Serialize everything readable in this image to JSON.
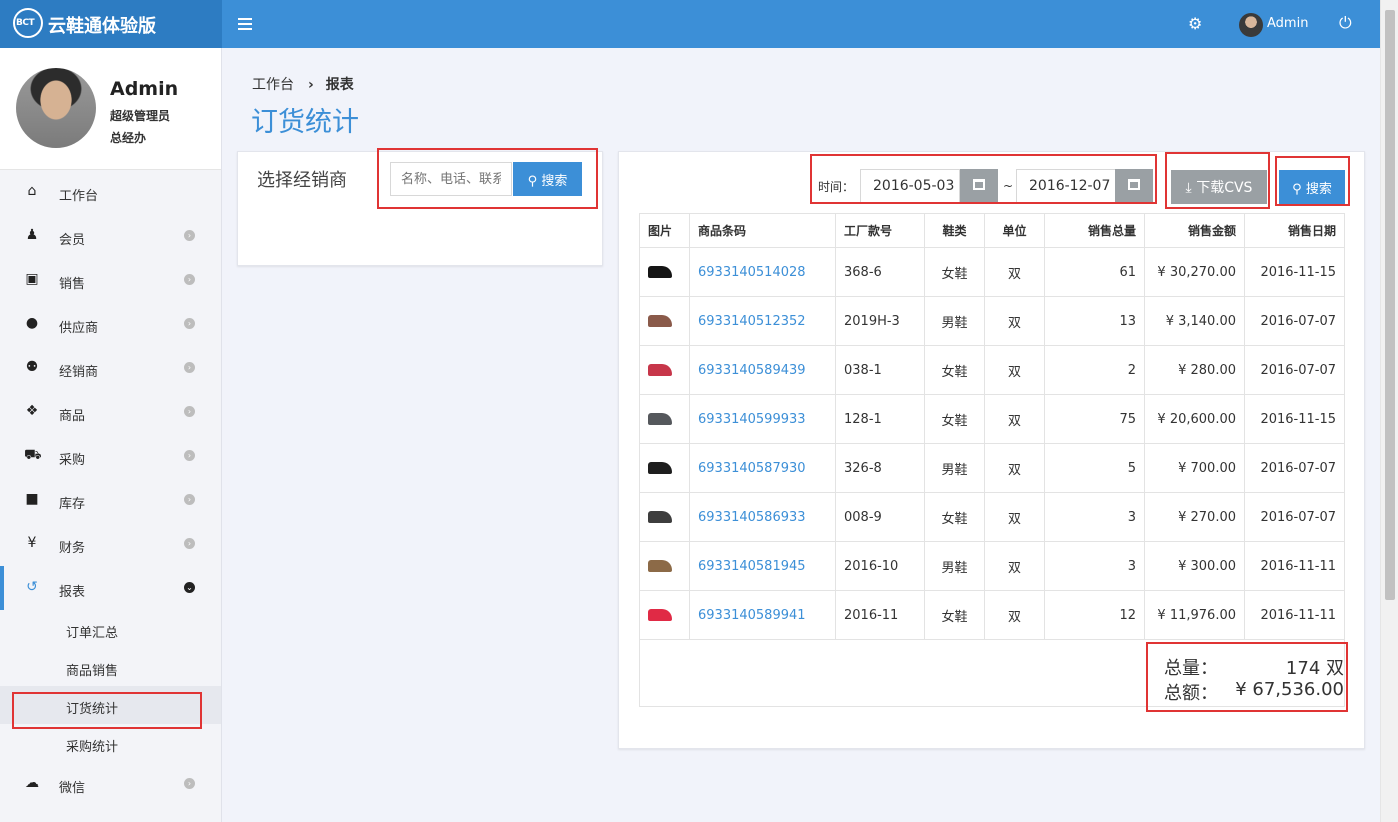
{
  "brand": {
    "logo_text": "BCT",
    "title": "云鞋通体验版"
  },
  "topbar": {
    "user": "Admin"
  },
  "profile": {
    "name": "Admin",
    "role": "超级管理员",
    "dept": "总经办"
  },
  "nav": [
    {
      "label": "工作台",
      "icon": "home-icon"
    },
    {
      "label": "会员",
      "icon": "person-icon"
    },
    {
      "label": "销售",
      "icon": "money-icon"
    },
    {
      "label": "供应商",
      "icon": "user-icon"
    },
    {
      "label": "经销商",
      "icon": "users-icon"
    },
    {
      "label": "商品",
      "icon": "cubes-icon"
    },
    {
      "label": "采购",
      "icon": "cart-icon"
    },
    {
      "label": "库存",
      "icon": "archive-icon"
    },
    {
      "label": "财务",
      "icon": "yen-icon",
      "glyph": "¥"
    },
    {
      "label": "报表",
      "icon": "history-icon"
    },
    {
      "label": "微信",
      "icon": "wechat-icon"
    }
  ],
  "subnav": [
    {
      "label": "订单汇总"
    },
    {
      "label": "商品销售"
    },
    {
      "label": "订货统计"
    },
    {
      "label": "采购统计"
    }
  ],
  "breadcrumb": {
    "home": "工作台",
    "sep": "›",
    "current": "报表"
  },
  "page_title": "订货统计",
  "dealer": {
    "label": "选择经销商",
    "placeholder": "名称、电话、联系",
    "search": "搜索"
  },
  "filter": {
    "time_label": "时间：",
    "start": "2016-05-03",
    "tilde": "~",
    "end": "2016-12-07",
    "download": "下载CVS",
    "search": "搜索"
  },
  "table": {
    "headers": [
      "图片",
      "商品条码",
      "工厂款号",
      "鞋类",
      "单位",
      "销售总量",
      "销售金额",
      "销售日期"
    ],
    "rows": [
      {
        "barcode": "6933140514028",
        "style": "368-6",
        "type": "女鞋",
        "unit": "双",
        "qty": "61",
        "amount": "¥ 30,270.00",
        "date": "2016-11-15",
        "color": "#151515"
      },
      {
        "barcode": "6933140512352",
        "style": "2019H-3",
        "type": "男鞋",
        "unit": "双",
        "qty": "13",
        "amount": "¥ 3,140.00",
        "date": "2016-07-07",
        "color": "#8a5a4a"
      },
      {
        "barcode": "6933140589439",
        "style": "038-1",
        "type": "女鞋",
        "unit": "双",
        "qty": "2",
        "amount": "¥ 280.00",
        "date": "2016-07-07",
        "color": "#c7364a"
      },
      {
        "barcode": "6933140599933",
        "style": "128-1",
        "type": "女鞋",
        "unit": "双",
        "qty": "75",
        "amount": "¥ 20,600.00",
        "date": "2016-11-15",
        "color": "#55585c"
      },
      {
        "barcode": "6933140587930",
        "style": "326-8",
        "type": "男鞋",
        "unit": "双",
        "qty": "5",
        "amount": "¥ 700.00",
        "date": "2016-07-07",
        "color": "#1e1e1e"
      },
      {
        "barcode": "6933140586933",
        "style": "008-9",
        "type": "女鞋",
        "unit": "双",
        "qty": "3",
        "amount": "¥ 270.00",
        "date": "2016-07-07",
        "color": "#3d3d3d"
      },
      {
        "barcode": "6933140581945",
        "style": "2016-10",
        "type": "男鞋",
        "unit": "双",
        "qty": "3",
        "amount": "¥ 300.00",
        "date": "2016-11-11",
        "color": "#8c6a47"
      },
      {
        "barcode": "6933140589941",
        "style": "2016-11",
        "type": "女鞋",
        "unit": "双",
        "qty": "12",
        "amount": "¥ 11,976.00",
        "date": "2016-11-11",
        "color": "#e02a45"
      }
    ]
  },
  "summary": {
    "total_qty_label": "总量：",
    "total_qty": "174 双",
    "total_amount_label": "总额：",
    "total_amount": "¥ 67,536.00"
  },
  "colors": {
    "primary": "#3c8fd7",
    "highlight": "#e03434",
    "muted_button": "#9aa0a4"
  }
}
